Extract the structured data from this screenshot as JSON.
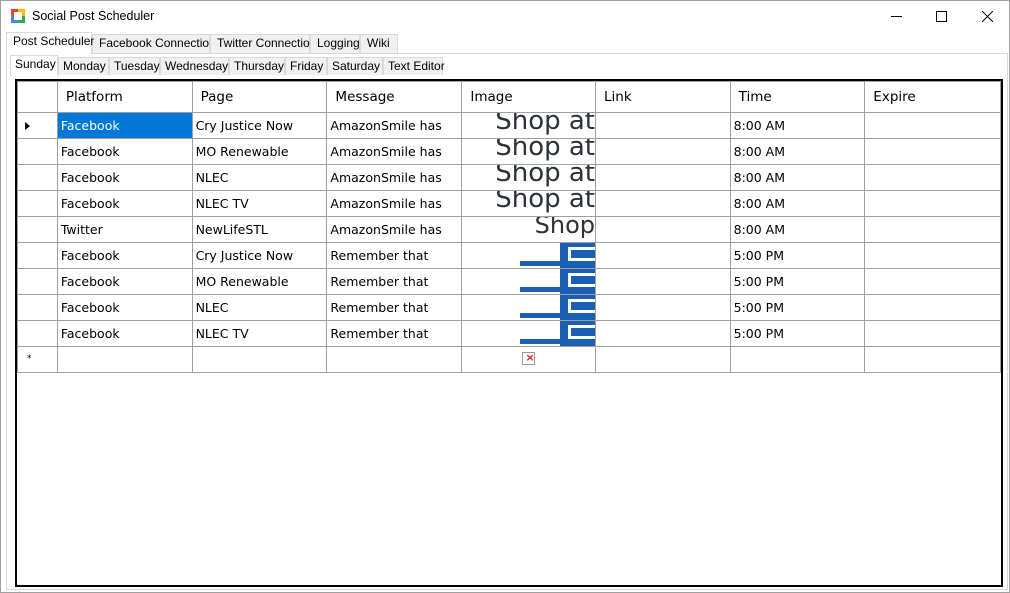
{
  "window": {
    "title": "Social Post Scheduler",
    "icon": "app-grid-icon",
    "controls": [
      "minimize-icon",
      "maximize-icon",
      "close-icon"
    ]
  },
  "outer_tabs": [
    {
      "label": "Post Scheduler",
      "active": true
    },
    {
      "label": "Facebook Connection",
      "active": false
    },
    {
      "label": "Twitter Connection",
      "active": false
    },
    {
      "label": "Logging",
      "active": false
    },
    {
      "label": "Wiki",
      "active": false
    }
  ],
  "day_tabs": [
    {
      "label": "Sunday",
      "active": true
    },
    {
      "label": "Monday",
      "active": false
    },
    {
      "label": "Tuesday",
      "active": false
    },
    {
      "label": "Wednesday",
      "active": false
    },
    {
      "label": "Thursday",
      "active": false
    },
    {
      "label": "Friday",
      "active": false
    },
    {
      "label": "Saturday",
      "active": false
    },
    {
      "label": "Text Editor",
      "active": false
    }
  ],
  "grid": {
    "columns": [
      "Platform",
      "Page",
      "Message",
      "Image",
      "Link",
      "Time",
      "Expire"
    ],
    "rows": [
      {
        "platform": "Facebook",
        "page": "Cry Justice Now",
        "message": "AmazonSmile has",
        "image": "Shop at",
        "link": "",
        "time": "8:00 AM",
        "expire": "",
        "current": true
      },
      {
        "platform": "Facebook",
        "page": "MO Renewable",
        "message": "AmazonSmile has",
        "image": "Shop at",
        "link": "",
        "time": "8:00 AM",
        "expire": ""
      },
      {
        "platform": "Facebook",
        "page": "NLEC",
        "message": "AmazonSmile has",
        "image": "Shop at",
        "link": "",
        "time": "8:00 AM",
        "expire": ""
      },
      {
        "platform": "Facebook",
        "page": "NLEC TV",
        "message": "AmazonSmile has",
        "image": "Shop at",
        "link": "",
        "time": "8:00 AM",
        "expire": ""
      },
      {
        "platform": "Twitter",
        "page": "NewLifeSTL",
        "message": "AmazonSmile has",
        "image": "Shop",
        "link": "",
        "time": "8:00 AM",
        "expire": ""
      },
      {
        "platform": "Facebook",
        "page": "Cry Justice Now",
        "message": "Remember that",
        "image": "",
        "link": "",
        "time": "5:00 PM",
        "expire": ""
      },
      {
        "platform": "Facebook",
        "page": "MO Renewable",
        "message": "Remember that",
        "image": "",
        "link": "",
        "time": "5:00 PM",
        "expire": ""
      },
      {
        "platform": "Facebook",
        "page": "NLEC",
        "message": "Remember that",
        "image": "",
        "link": "",
        "time": "5:00 PM",
        "expire": ""
      },
      {
        "platform": "Facebook",
        "page": "NLEC TV",
        "message": "Remember that",
        "image": "",
        "link": "",
        "time": "5:00 PM",
        "expire": ""
      }
    ],
    "new_row_glyph": "*",
    "broken_image_glyph": "×",
    "selection_color": "#0078d7",
    "logo_color": "#1a5fb4"
  }
}
